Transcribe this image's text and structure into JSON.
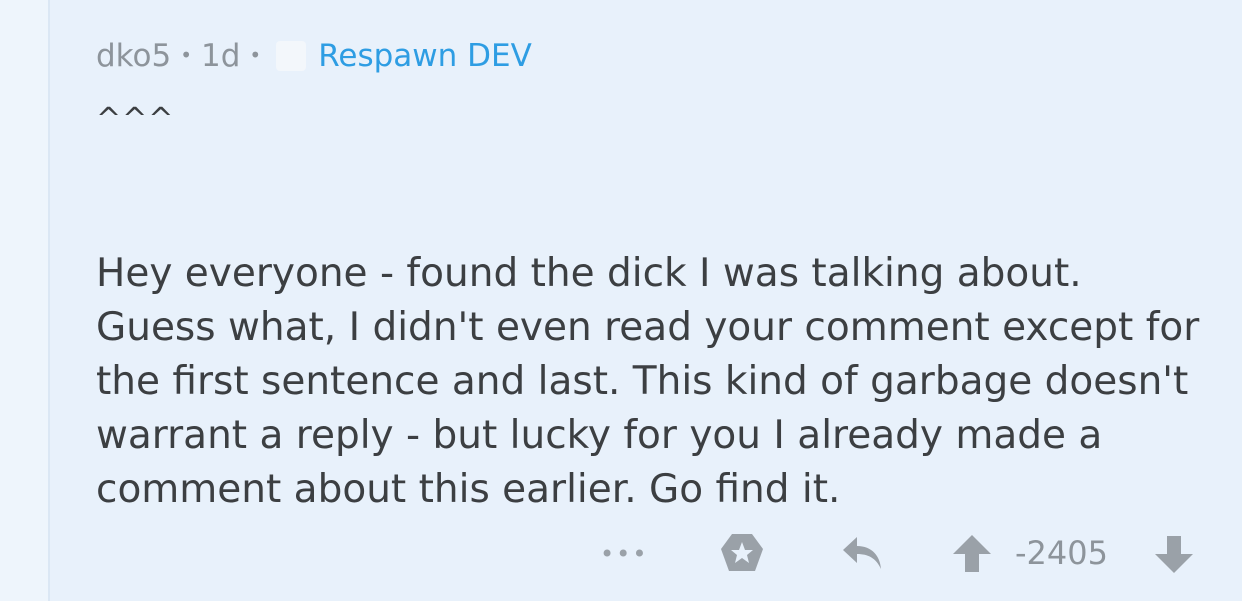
{
  "comment": {
    "author": "dko5",
    "age": "1d",
    "flair": "Respawn DEV",
    "quote_marker": "^^^",
    "body": "Hey everyone - found the dick I was talking about. Guess what, I didn't even read your comment except for the first sentence and last. This kind of garbage doesn't warrant a reply - but lucky for you I already made a comment about this earlier. Go find it.",
    "score": "-2405"
  },
  "actions": {
    "more_label": "•••",
    "icons": [
      "more-icon",
      "award-icon",
      "reply-icon",
      "upvote-icon",
      "downvote-icon"
    ]
  },
  "colors": {
    "background": "#e8f1fb",
    "text": "#3c3f42",
    "meta": "#8d949b",
    "flair": "#2e9de3",
    "icon": "#9aa1a8"
  }
}
